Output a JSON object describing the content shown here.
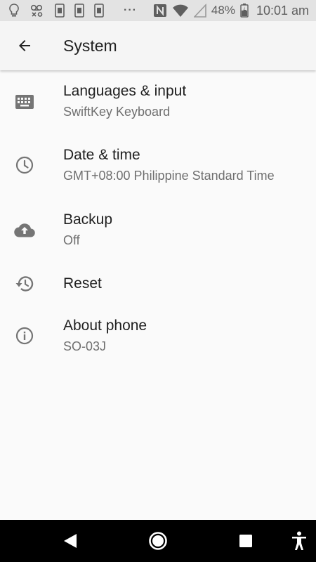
{
  "status_bar": {
    "battery_percent": "48%",
    "time": "10:01 am",
    "overflow": "···",
    "icons": [
      "bulb-icon",
      "voicemail-icon",
      "sim-icon",
      "sim-icon",
      "sim-icon",
      "more-icon",
      "nfc-icon",
      "wifi-icon",
      "signal-icon",
      "battery-icon"
    ]
  },
  "app_bar": {
    "title": "System"
  },
  "items": [
    {
      "title": "Languages & input",
      "subtitle": "SwiftKey Keyboard",
      "icon": "keyboard-icon"
    },
    {
      "title": "Date & time",
      "subtitle": "GMT+08:00 Philippine Standard Time",
      "icon": "clock-icon"
    },
    {
      "title": "Backup",
      "subtitle": "Off",
      "icon": "cloud-upload-icon"
    },
    {
      "title": "Reset",
      "icon": "restore-icon"
    },
    {
      "title": "About phone",
      "subtitle": "SO-03J",
      "icon": "info-icon"
    }
  ],
  "nav_bar": {
    "buttons": [
      "back-icon",
      "home-icon",
      "recents-icon",
      "accessibility-icon"
    ]
  },
  "colors": {
    "status_bar_bg": "#e3e3e3",
    "app_bar_bg": "#f5f5f5",
    "page_bg": "#fafafa",
    "icon_gray": "#757575",
    "subtitle_gray": "#6f6f6f",
    "nav_bar_bg": "#000000"
  }
}
